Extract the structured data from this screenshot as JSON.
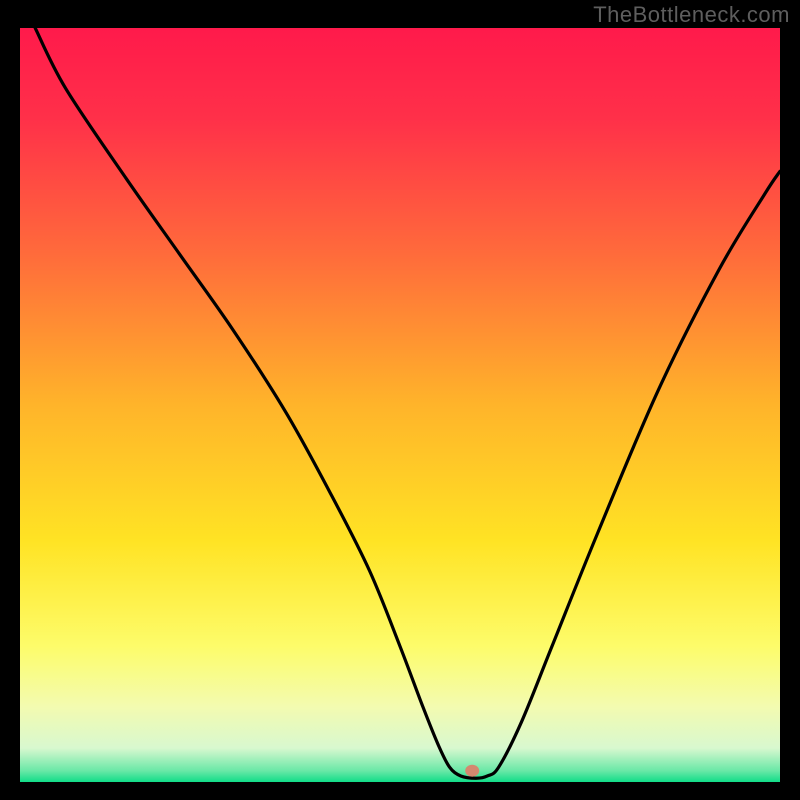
{
  "watermark": "TheBottleneck.com",
  "chart_data": {
    "type": "line",
    "title": "",
    "xlabel": "",
    "ylabel": "",
    "xlim": [
      0,
      100
    ],
    "ylim": [
      0,
      100
    ],
    "grid": false,
    "legend": false,
    "gradient_stops": [
      {
        "offset": 0.0,
        "color": "#ff1a4b"
      },
      {
        "offset": 0.12,
        "color": "#ff3049"
      },
      {
        "offset": 0.3,
        "color": "#ff6b3b"
      },
      {
        "offset": 0.5,
        "color": "#ffb42a"
      },
      {
        "offset": 0.68,
        "color": "#ffe324"
      },
      {
        "offset": 0.82,
        "color": "#fdfc6a"
      },
      {
        "offset": 0.9,
        "color": "#f3fbb0"
      },
      {
        "offset": 0.955,
        "color": "#d8f8cf"
      },
      {
        "offset": 0.985,
        "color": "#6ae8a7"
      },
      {
        "offset": 1.0,
        "color": "#11dd88"
      }
    ],
    "series": [
      {
        "name": "bottleneck-curve",
        "x": [
          2,
          6,
          14,
          21,
          28,
          35,
          41,
          46,
          50,
          53,
          55,
          56.5,
          58,
          60,
          61.5,
          63,
          66,
          70,
          76,
          84,
          92,
          98,
          100
        ],
        "y": [
          100,
          92,
          80,
          70,
          60,
          49,
          38,
          28,
          18,
          10,
          5,
          2,
          0.8,
          0.5,
          0.8,
          2,
          8,
          18,
          33,
          52,
          68,
          78,
          81
        ]
      }
    ],
    "marker": {
      "x": 59.5,
      "y": 1.5,
      "color": "#d4886f",
      "rx": 7,
      "ry": 6
    }
  }
}
